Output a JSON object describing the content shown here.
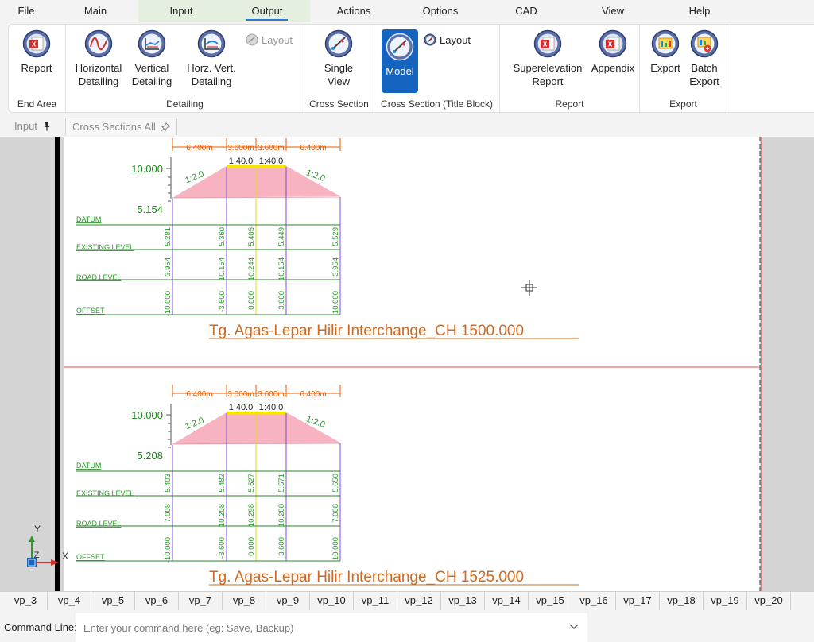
{
  "menu": {
    "items": [
      "File",
      "Main",
      "Input",
      "Output",
      "Actions",
      "Options",
      "CAD",
      "View",
      "Help"
    ],
    "active": "Output"
  },
  "ribbon": {
    "end_area": {
      "label": "End Area",
      "report": "Report"
    },
    "detailing": {
      "label": "Detailing",
      "horizontal": [
        "Horizontal",
        "Detailing"
      ],
      "vertical": [
        "Vertical",
        "Detailing"
      ],
      "horz_vert": [
        "Horz. Vert.",
        "Detailing"
      ],
      "layout": "Layout"
    },
    "cross_section": {
      "label": "Cross Section",
      "single_view": [
        "Single",
        "View"
      ]
    },
    "title_block": {
      "label": "Cross Section (Title Block)",
      "model": "Model",
      "layout": "Layout"
    },
    "report": {
      "label": "Report",
      "superelevation": [
        "Superelevation",
        "Report"
      ],
      "appendix": "Appendix"
    },
    "export": {
      "label": "Export",
      "export": "Export",
      "batch": [
        "Batch",
        "Export"
      ]
    }
  },
  "doc_tabs": {
    "input": "Input",
    "cross_sections": "Cross Sections All"
  },
  "sections": [
    {
      "title": "Tg. Agas-Lepar Hilir Interchange_CH 1500.000",
      "level_top": "10.000",
      "datum_value": "5.154",
      "dims": [
        "6.400m",
        "3.600m",
        "3.600m",
        "6.400m"
      ],
      "slopes_center": [
        "1:40.0",
        "1:40.0"
      ],
      "side_slopes": [
        "1:2.0",
        "1:2.0"
      ],
      "existing": [
        "5.281",
        "5.360",
        "5.405",
        "5.449",
        "5.529"
      ],
      "road": [
        "3.954",
        "10.154",
        "10.244",
        "10.154",
        "3.954"
      ],
      "offset": [
        "-10.000",
        "-3.600",
        "0.000",
        "3.600",
        "10.000"
      ]
    },
    {
      "title": "Tg. Agas-Lepar Hilir Interchange_CH 1525.000",
      "level_top": "10.000",
      "datum_value": "5.208",
      "dims": [
        "6.400m",
        "3.600m",
        "3.600m",
        "6.400m"
      ],
      "slopes_center": [
        "1:40.0",
        "1:40.0"
      ],
      "side_slopes": [
        "1:2.0",
        "1:2.0"
      ],
      "existing": [
        "5.403",
        "5.482",
        "5.527",
        "5.571",
        "5.650"
      ],
      "road": [
        "7.008",
        "10.208",
        "10.298",
        "10.208",
        "7.008"
      ],
      "offset": [
        "-10.000",
        "-3.600",
        "0.000",
        "3.600",
        "10.000"
      ]
    }
  ],
  "row_labels": {
    "datum": "DATUM",
    "existing": "EXISTING LEVEL",
    "road": "ROAD LEVEL",
    "offset": "OFFSET"
  },
  "ucs": {
    "y": "Y",
    "z": "Z",
    "x": "X"
  },
  "viewports": [
    "vp_3",
    "vp_4",
    "vp_5",
    "vp_6",
    "vp_7",
    "vp_8",
    "vp_9",
    "vp_10",
    "vp_11",
    "vp_12",
    "vp_13",
    "vp_14",
    "vp_15",
    "vp_16",
    "vp_17",
    "vp_18",
    "vp_19",
    "vp_20"
  ],
  "command_line": {
    "label": "Command Line:",
    "placeholder": "Enter your command here (eg: Save, Backup)"
  },
  "colors": {
    "title": "#d2691e",
    "dim": "#e65c00",
    "text_green": "#2a9a2a",
    "fill": "#f7b3c0",
    "accent": "#1565c0"
  }
}
